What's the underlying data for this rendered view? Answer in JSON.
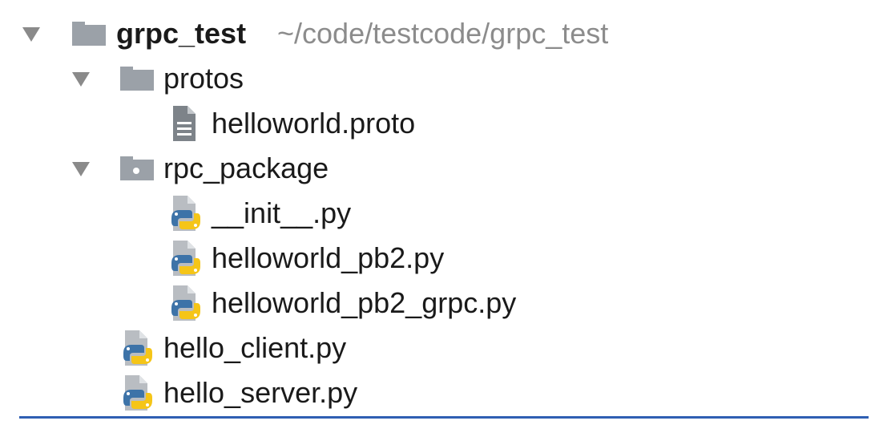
{
  "project": {
    "name": "grpc_test",
    "path": "~/code/testcode/grpc_test"
  },
  "tree": {
    "protos": {
      "name": "protos",
      "files": [
        "helloworld.proto"
      ]
    },
    "rpc_package": {
      "name": "rpc_package",
      "files": [
        "__init__.py",
        "helloworld_pb2.py",
        "helloworld_pb2_grpc.py"
      ]
    },
    "root_files": [
      "hello_client.py",
      "hello_server.py"
    ]
  },
  "colors": {
    "arrow": "#8a8a8a",
    "folder": "#9ba1a8",
    "path_text": "#8c8c8c",
    "python_blue": "#3d73a8",
    "python_yellow": "#f5c518",
    "selection_line": "#2f5fb3"
  },
  "icons": {
    "expanded": "triangle-down-icon",
    "folder": "folder-icon",
    "package": "package-folder-icon",
    "proto_file": "text-file-icon",
    "python_file": "python-file-icon"
  }
}
